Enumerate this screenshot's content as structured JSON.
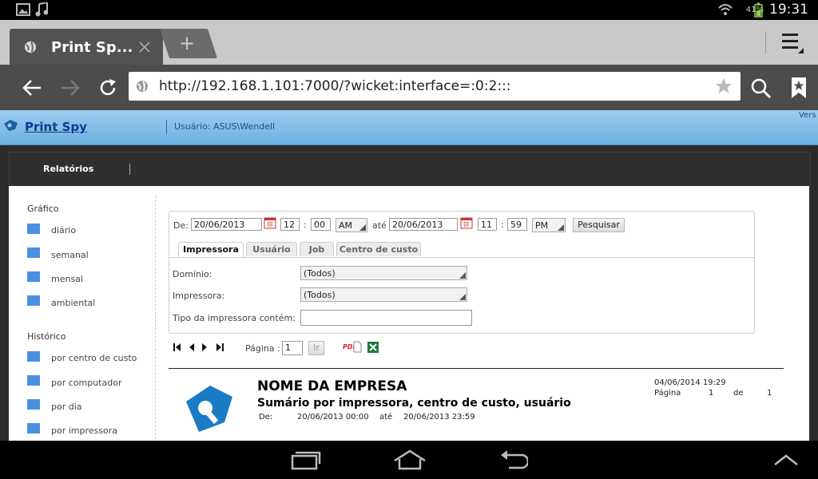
{
  "status_bar": {
    "battery": "41%",
    "time": "19:31"
  },
  "browser": {
    "tab_title": "Print Sp...",
    "new_tab": "+",
    "url": "http://192.168.1.101:7000/?wicket:interface=:0:2:::"
  },
  "app": {
    "title": "Print Spy",
    "user": "Usuário: ASUS\\Wendell",
    "version_cut": "Vers",
    "nav": {
      "relatorios": "Relatórios"
    }
  },
  "sidebar": {
    "grafico_heading": "Gráfico",
    "grafico_items": [
      "diário",
      "semanal",
      "mensal",
      "ambiental"
    ],
    "historico_heading": "Histórico",
    "historico_items": [
      "por centro de custo",
      "por computador",
      "por dia",
      "por impressora"
    ]
  },
  "filter": {
    "from_label": "De:",
    "from_date": "20/06/2013",
    "from_hour": "12",
    "from_min": "00",
    "from_ampm": "AM",
    "to_label": "até",
    "to_date": "20/06/2013",
    "to_hour": "11",
    "to_min": "59",
    "to_ampm": "PM",
    "colon": ":",
    "search_button": "Pesquisar",
    "tabs": [
      "Impressora",
      "Usuário",
      "Job",
      "Centro de custo"
    ],
    "dominio_label": "Domínio:",
    "dominio_value": "(Todos)",
    "impressora_label": "Impressora:",
    "impressora_value": "(Todos)",
    "tipo_label": "Tipo da impressora contém:",
    "tipo_value": ""
  },
  "pager": {
    "page_label": "Página :",
    "page_value": "1",
    "go_button": "Ir",
    "pdf_label": "PDF"
  },
  "report": {
    "company": "NOME DA EMPRESA",
    "subtitle": "Sumário por impressora, centro de custo, usuário",
    "de_label": "De:",
    "from": "20/06/2013 00:00",
    "ate_label": "até",
    "to": "20/06/2013 23:59",
    "generated": "04/06/2014 19:29",
    "pagina_label": "Página",
    "page_current": "1",
    "de2_label": "de",
    "page_total": "1"
  },
  "colors": {
    "accent": "#4a90e2",
    "header_top": "#9ccdf0",
    "logo": "#1b7bc4"
  }
}
